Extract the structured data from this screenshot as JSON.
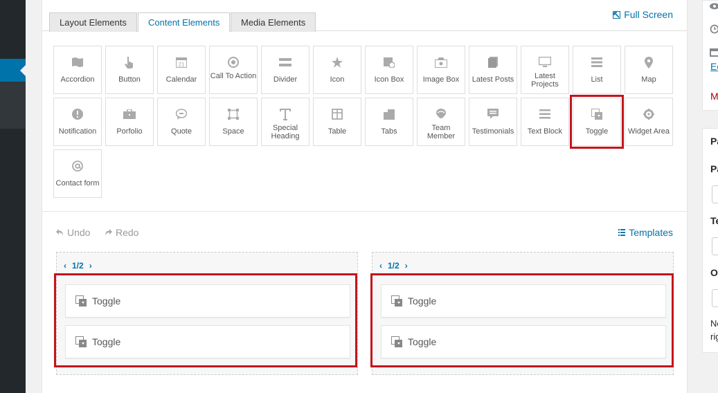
{
  "tabs": [
    {
      "label": "Layout Elements"
    },
    {
      "label": "Content Elements"
    },
    {
      "label": "Media Elements"
    }
  ],
  "full_screen_label": "Full Screen",
  "elements": [
    {
      "label": "Accordion",
      "icon": "accordion-icon"
    },
    {
      "label": "Button",
      "icon": "pointer-icon"
    },
    {
      "label": "Calendar",
      "icon": "calendar-icon"
    },
    {
      "label": "Call To Action",
      "icon": "target-icon"
    },
    {
      "label": "Divider",
      "icon": "divider-icon"
    },
    {
      "label": "Icon",
      "icon": "star-icon"
    },
    {
      "label": "Icon Box",
      "icon": "icon-box-icon"
    },
    {
      "label": "Image Box",
      "icon": "image-icon"
    },
    {
      "label": "Latest Posts",
      "icon": "posts-icon"
    },
    {
      "label": "Latest Projects",
      "icon": "monitor-icon"
    },
    {
      "label": "List",
      "icon": "list-icon"
    },
    {
      "label": "Map",
      "icon": "map-pin-icon"
    },
    {
      "label": "Notification",
      "icon": "alert-icon"
    },
    {
      "label": "Porfolio",
      "icon": "briefcase-icon"
    },
    {
      "label": "Quote",
      "icon": "speech-bubble-icon"
    },
    {
      "label": "Space",
      "icon": "space-icon"
    },
    {
      "label": "Special Heading",
      "icon": "text-t-icon"
    },
    {
      "label": "Table",
      "icon": "table-icon"
    },
    {
      "label": "Tabs",
      "icon": "tabs-icon"
    },
    {
      "label": "Team Member",
      "icon": "person-icon"
    },
    {
      "label": "Testimonials",
      "icon": "testimonial-icon"
    },
    {
      "label": "Text Block",
      "icon": "text-block-icon"
    },
    {
      "label": "Toggle",
      "icon": "toggle-icon"
    },
    {
      "label": "Widget Area",
      "icon": "gear-icon"
    },
    {
      "label": "Contact form",
      "icon": "at-sign-icon"
    }
  ],
  "highlighted_element": "Toggle",
  "toolbar": {
    "undo": "Undo",
    "redo": "Redo",
    "templates": "Templates"
  },
  "columns": [
    {
      "size": "1/2",
      "items": [
        "Toggle",
        "Toggle"
      ]
    },
    {
      "size": "1/2",
      "items": [
        "Toggle",
        "Toggle"
      ]
    }
  ],
  "sidebar_fragments": {
    "edit_link": "Ec",
    "move_text": "M",
    "panel_title": "Pa",
    "label_1": "Pa",
    "label_2": "Te",
    "label_3": "O",
    "note_1": "Nc",
    "note_2": "rig"
  },
  "colors": {
    "accent": "#0073aa",
    "highlight": "#c4141c",
    "admin_dark": "#23282d"
  }
}
